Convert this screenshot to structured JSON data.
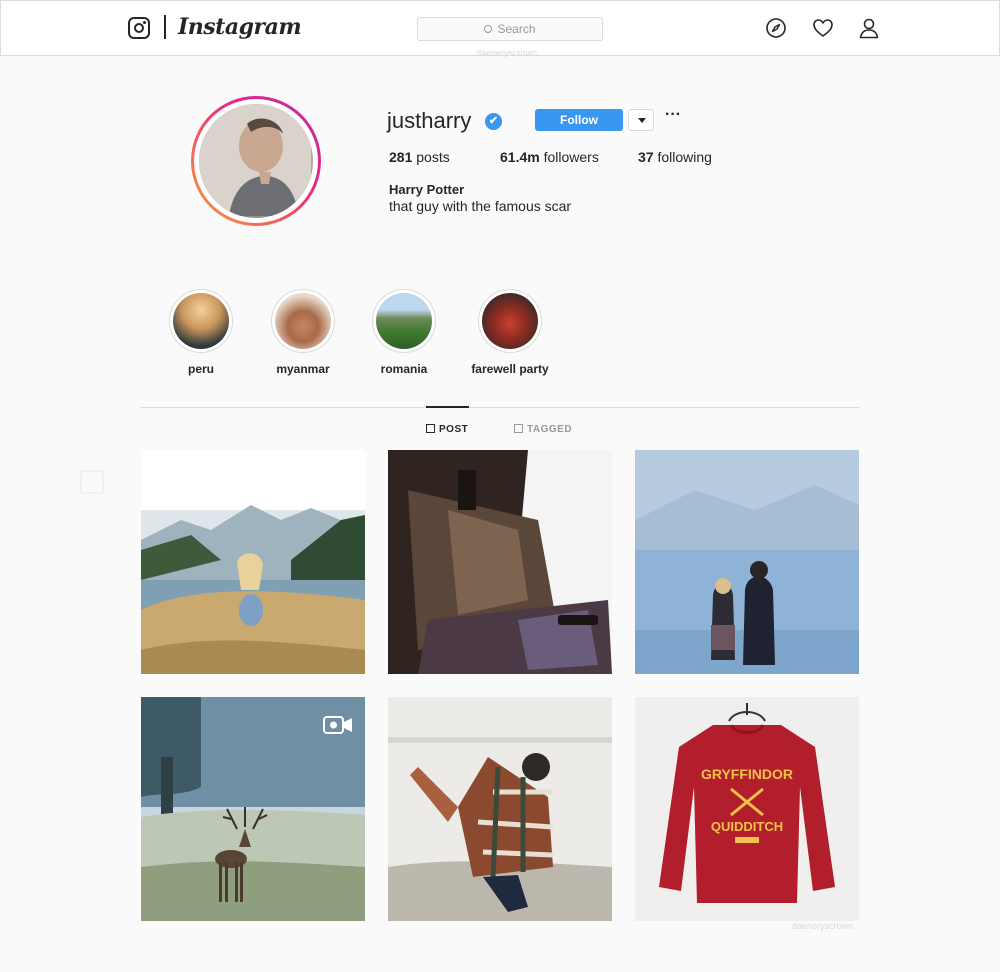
{
  "nav": {
    "brand": "Instagram",
    "search_placeholder": "Search",
    "watermark_top": "daeneryscrown"
  },
  "profile": {
    "username": "justharry",
    "verified_icon": "✔",
    "follow_label": "Follow",
    "more_label": "···",
    "stats": {
      "posts_count": "281",
      "posts_label": "posts",
      "followers_count": "61.4m",
      "followers_label": "followers",
      "following_count": "37",
      "following_label": "following"
    },
    "full_name": "Harry Potter",
    "bio": "that guy with the famous scar"
  },
  "highlights": [
    {
      "label": "peru"
    },
    {
      "label": "myanmar"
    },
    {
      "label": "romania"
    },
    {
      "label": "farewell party"
    }
  ],
  "tabs": [
    {
      "label": "POST",
      "active": true
    },
    {
      "label": "TAGGED",
      "active": false
    }
  ],
  "posts": [
    {
      "icon": "landscape"
    },
    {
      "icon": "suitcase"
    },
    {
      "icon": "lake-couple"
    },
    {
      "icon": "deer",
      "video": true
    },
    {
      "icon": "plaid-shirt"
    },
    {
      "icon": "red-sweater"
    }
  ],
  "watermark_bottom": "daeneryscrown",
  "colors": {
    "accent": "#3897f0",
    "border": "#dbdbdb",
    "text": "#262626",
    "muted": "#999999",
    "sweater_red": "#b21e2b"
  }
}
